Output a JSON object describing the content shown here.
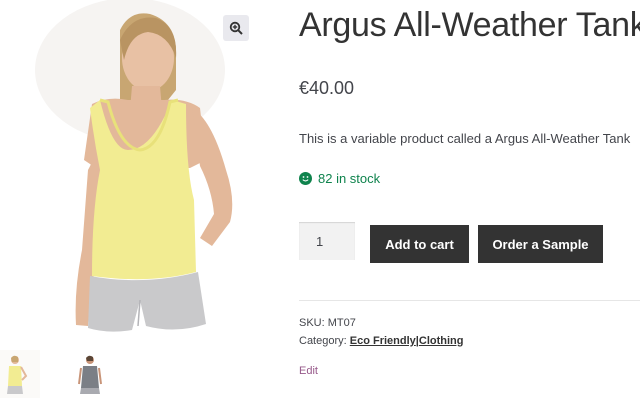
{
  "product": {
    "title": "Argus All-Weather Tank",
    "price": "€40.00",
    "description": "This is a variable product called a Argus All-Weather Tank",
    "stock": "82 in stock",
    "quantity": "1",
    "sku_label": "SKU:",
    "sku_value": "MT07",
    "category_label": "Category:",
    "categories": [
      "Eco Friendly",
      "Clothing"
    ],
    "category_separator": "|"
  },
  "actions": {
    "add_to_cart": "Add to cart",
    "order_sample": "Order a Sample",
    "edit": "Edit"
  },
  "gallery": {
    "zoom_icon": "magnifier-plus-icon",
    "thumbnails": [
      "yellow-tank-front",
      "gray-tank-back"
    ]
  },
  "colors": {
    "button_bg": "#333333",
    "stock_green": "#0f834d",
    "edit_link": "#96588a",
    "tank_yellow": "#f2ec92",
    "shorts_gray": "#c9c9cb"
  }
}
